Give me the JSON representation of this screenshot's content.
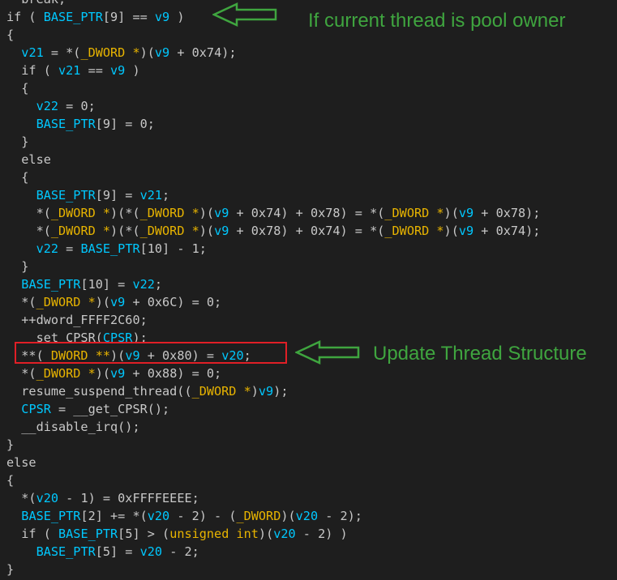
{
  "colors": {
    "background": "#1e1e1e",
    "plain_text": "#c8c8c8",
    "identifier": "#00c8ff",
    "type_keyword": "#e8b400",
    "annotation_green": "#3fa53f",
    "highlight_red": "#e01f26"
  },
  "annotations": {
    "pool_owner": "If current thread is pool owner",
    "update_thread": "Update Thread Structure"
  },
  "code_lines": [
    [
      {
        "t": "  break;",
        "c": "kw"
      }
    ],
    [
      {
        "t": "if ( ",
        "c": "kw"
      },
      {
        "t": "BASE_PTR",
        "c": "var"
      },
      {
        "t": "[9] == ",
        "c": "punc"
      },
      {
        "t": "v9",
        "c": "var"
      },
      {
        "t": " )",
        "c": "punc"
      }
    ],
    [
      {
        "t": "{",
        "c": "punc"
      }
    ],
    [
      {
        "t": "  ",
        "c": "punc"
      },
      {
        "t": "v21",
        "c": "var"
      },
      {
        "t": " = *(",
        "c": "punc"
      },
      {
        "t": "_DWORD *",
        "c": "type"
      },
      {
        "t": ")(",
        "c": "punc"
      },
      {
        "t": "v9",
        "c": "var"
      },
      {
        "t": " + 0x74);",
        "c": "punc"
      }
    ],
    [
      {
        "t": "  if ( ",
        "c": "kw"
      },
      {
        "t": "v21",
        "c": "var"
      },
      {
        "t": " == ",
        "c": "punc"
      },
      {
        "t": "v9",
        "c": "var"
      },
      {
        "t": " )",
        "c": "punc"
      }
    ],
    [
      {
        "t": "  {",
        "c": "punc"
      }
    ],
    [
      {
        "t": "    ",
        "c": "punc"
      },
      {
        "t": "v22",
        "c": "var"
      },
      {
        "t": " = 0;",
        "c": "punc"
      }
    ],
    [
      {
        "t": "    ",
        "c": "punc"
      },
      {
        "t": "BASE_PTR",
        "c": "var"
      },
      {
        "t": "[9] = 0;",
        "c": "punc"
      }
    ],
    [
      {
        "t": "  }",
        "c": "punc"
      }
    ],
    [
      {
        "t": "  else",
        "c": "kw"
      }
    ],
    [
      {
        "t": "  {",
        "c": "punc"
      }
    ],
    [
      {
        "t": "    ",
        "c": "punc"
      },
      {
        "t": "BASE_PTR",
        "c": "var"
      },
      {
        "t": "[9] = ",
        "c": "punc"
      },
      {
        "t": "v21",
        "c": "var"
      },
      {
        "t": ";",
        "c": "punc"
      }
    ],
    [
      {
        "t": "    *(",
        "c": "punc"
      },
      {
        "t": "_DWORD *",
        "c": "type"
      },
      {
        "t": ")(*(",
        "c": "punc"
      },
      {
        "t": "_DWORD *",
        "c": "type"
      },
      {
        "t": ")(",
        "c": "punc"
      },
      {
        "t": "v9",
        "c": "var"
      },
      {
        "t": " + 0x74) + 0x78) = *(",
        "c": "punc"
      },
      {
        "t": "_DWORD *",
        "c": "type"
      },
      {
        "t": ")(",
        "c": "punc"
      },
      {
        "t": "v9",
        "c": "var"
      },
      {
        "t": " + 0x78);",
        "c": "punc"
      }
    ],
    [
      {
        "t": "    *(",
        "c": "punc"
      },
      {
        "t": "_DWORD *",
        "c": "type"
      },
      {
        "t": ")(*(",
        "c": "punc"
      },
      {
        "t": "_DWORD *",
        "c": "type"
      },
      {
        "t": ")(",
        "c": "punc"
      },
      {
        "t": "v9",
        "c": "var"
      },
      {
        "t": " + 0x78) + 0x74) = *(",
        "c": "punc"
      },
      {
        "t": "_DWORD *",
        "c": "type"
      },
      {
        "t": ")(",
        "c": "punc"
      },
      {
        "t": "v9",
        "c": "var"
      },
      {
        "t": " + 0x74);",
        "c": "punc"
      }
    ],
    [
      {
        "t": "    ",
        "c": "punc"
      },
      {
        "t": "v22",
        "c": "var"
      },
      {
        "t": " = ",
        "c": "punc"
      },
      {
        "t": "BASE_PTR",
        "c": "var"
      },
      {
        "t": "[10] - 1;",
        "c": "punc"
      }
    ],
    [
      {
        "t": "  }",
        "c": "punc"
      }
    ],
    [
      {
        "t": "  ",
        "c": "punc"
      },
      {
        "t": "BASE_PTR",
        "c": "var"
      },
      {
        "t": "[10] = ",
        "c": "punc"
      },
      {
        "t": "v22",
        "c": "var"
      },
      {
        "t": ";",
        "c": "punc"
      }
    ],
    [
      {
        "t": "  *(",
        "c": "punc"
      },
      {
        "t": "_DWORD *",
        "c": "type"
      },
      {
        "t": ")(",
        "c": "punc"
      },
      {
        "t": "v9",
        "c": "var"
      },
      {
        "t": " + 0x6C) = 0;",
        "c": "punc"
      }
    ],
    [
      {
        "t": "  ++dword_FFFF2C60;",
        "c": "punc"
      }
    ],
    [
      {
        "t": "    set CPSR(",
        "c": "punc"
      },
      {
        "t": "CPSR",
        "c": "var"
      },
      {
        "t": ");",
        "c": "punc"
      }
    ],
    [
      {
        "t": "  **(",
        "c": "punc"
      },
      {
        "t": "_DWORD **",
        "c": "type"
      },
      {
        "t": ")(",
        "c": "punc"
      },
      {
        "t": "v9",
        "c": "var"
      },
      {
        "t": " + 0x80) = ",
        "c": "punc"
      },
      {
        "t": "v20",
        "c": "var"
      },
      {
        "t": ";",
        "c": "punc"
      }
    ],
    [
      {
        "t": "  *(",
        "c": "punc"
      },
      {
        "t": "_DWORD *",
        "c": "type"
      },
      {
        "t": ")(",
        "c": "punc"
      },
      {
        "t": "v9",
        "c": "var"
      },
      {
        "t": " + 0x88) = 0;",
        "c": "punc"
      }
    ],
    [
      {
        "t": "  resume_suspend_thread((",
        "c": "punc"
      },
      {
        "t": "_DWORD *",
        "c": "type"
      },
      {
        "t": ")",
        "c": "punc"
      },
      {
        "t": "v9",
        "c": "var"
      },
      {
        "t": ");",
        "c": "punc"
      }
    ],
    [
      {
        "t": "  ",
        "c": "punc"
      },
      {
        "t": "CPSR",
        "c": "var"
      },
      {
        "t": " = __get_CPSR();",
        "c": "punc"
      }
    ],
    [
      {
        "t": "  __disable_irq();",
        "c": "punc"
      }
    ],
    [
      {
        "t": "}",
        "c": "punc"
      }
    ],
    [
      {
        "t": "else",
        "c": "kw"
      }
    ],
    [
      {
        "t": "{",
        "c": "punc"
      }
    ],
    [
      {
        "t": "  *(",
        "c": "punc"
      },
      {
        "t": "v20",
        "c": "var"
      },
      {
        "t": " - 1) = 0xFFFFEEEE;",
        "c": "punc"
      }
    ],
    [
      {
        "t": "  ",
        "c": "punc"
      },
      {
        "t": "BASE_PTR",
        "c": "var"
      },
      {
        "t": "[2] += *(",
        "c": "punc"
      },
      {
        "t": "v20",
        "c": "var"
      },
      {
        "t": " - 2) - (",
        "c": "punc"
      },
      {
        "t": "_DWORD",
        "c": "type"
      },
      {
        "t": ")(",
        "c": "punc"
      },
      {
        "t": "v20",
        "c": "var"
      },
      {
        "t": " - 2);",
        "c": "punc"
      }
    ],
    [
      {
        "t": "  if ( ",
        "c": "kw"
      },
      {
        "t": "BASE_PTR",
        "c": "var"
      },
      {
        "t": "[5] > (",
        "c": "punc"
      },
      {
        "t": "unsigned int",
        "c": "type"
      },
      {
        "t": ")(",
        "c": "punc"
      },
      {
        "t": "v20",
        "c": "var"
      },
      {
        "t": " - 2) )",
        "c": "punc"
      }
    ],
    [
      {
        "t": "    ",
        "c": "punc"
      },
      {
        "t": "BASE_PTR",
        "c": "var"
      },
      {
        "t": "[5] = ",
        "c": "punc"
      },
      {
        "t": "v20",
        "c": "var"
      },
      {
        "t": " - 2;",
        "c": "punc"
      }
    ],
    [
      {
        "t": "}",
        "c": "punc"
      }
    ]
  ]
}
